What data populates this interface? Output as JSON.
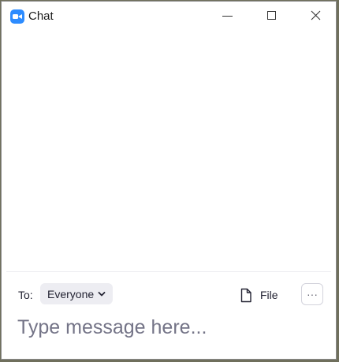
{
  "window": {
    "title": "Chat",
    "app_icon": "zoom-video-icon",
    "controls": {
      "minimize": "minimize-icon",
      "maximize": "maximize-icon",
      "close": "close-icon"
    }
  },
  "compose": {
    "to_label": "To:",
    "recipient": "Everyone",
    "file_label": "File",
    "more_label": "···",
    "placeholder": "Type message here..."
  },
  "colors": {
    "accent": "#2d8cff",
    "pill_bg": "#ededf2",
    "text": "#232333",
    "placeholder": "#747487"
  }
}
